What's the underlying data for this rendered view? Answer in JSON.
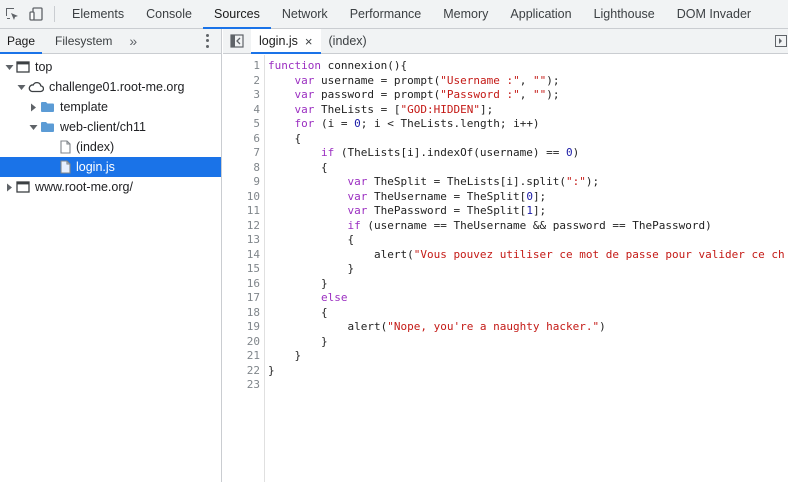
{
  "top_tabs": [
    "Elements",
    "Console",
    "Sources",
    "Network",
    "Performance",
    "Memory",
    "Application",
    "Lighthouse",
    "DOM Invader"
  ],
  "active_top_tab": "Sources",
  "navigator": {
    "tabs": [
      "Page",
      "Filesystem"
    ],
    "more_symbol": "»",
    "tree": [
      {
        "label": "top",
        "level": 0,
        "arrow": "down",
        "icon": "frame-icon"
      },
      {
        "label": "challenge01.root-me.org",
        "level": 1,
        "arrow": "down",
        "icon": "cloud-icon"
      },
      {
        "label": "template",
        "level": 2,
        "arrow": "right",
        "icon": "folder-icon"
      },
      {
        "label": "web-client/ch11",
        "level": 2,
        "arrow": "down",
        "icon": "folder-icon"
      },
      {
        "label": "(index)",
        "level": 3,
        "arrow": "none",
        "icon": "file-icon"
      },
      {
        "label": "login.js",
        "level": 3,
        "arrow": "none",
        "icon": "file-icon",
        "selected": true
      },
      {
        "label": "www.root-me.org/",
        "level": 0,
        "arrow": "right",
        "icon": "frame-icon"
      }
    ]
  },
  "editor": {
    "tabs": [
      {
        "label": "login.js",
        "active": true,
        "closable": true,
        "close_symbol": "×"
      },
      {
        "label": "(index)",
        "active": false,
        "closable": false
      }
    ],
    "lines": [
      "function connexion(){",
      "    var username = prompt(\"Username :\", \"\");",
      "    var password = prompt(\"Password :\", \"\");",
      "    var TheLists = [\"GOD:HIDDEN\"];",
      "    for (i = 0; i < TheLists.length; i++)",
      "    {",
      "        if (TheLists[i].indexOf(username) == 0)",
      "        {",
      "            var TheSplit = TheLists[i].split(\":\");",
      "            var TheUsername = TheSplit[0];",
      "            var ThePassword = TheSplit[1];",
      "            if (username == TheUsername && password == ThePassword)",
      "            {",
      "                alert(\"Vous pouvez utiliser ce mot de passe pour valider ce ch",
      "            }",
      "        }",
      "        else",
      "        {",
      "            alert(\"Nope, you're a naughty hacker.\")",
      "        }",
      "    }",
      "}",
      ""
    ]
  },
  "colors": {
    "accent": "#1a73e8",
    "keyword": "#9b2fc1",
    "string": "#c41a16",
    "number": "#1a1aa6",
    "folder": "#5b9bd5"
  }
}
